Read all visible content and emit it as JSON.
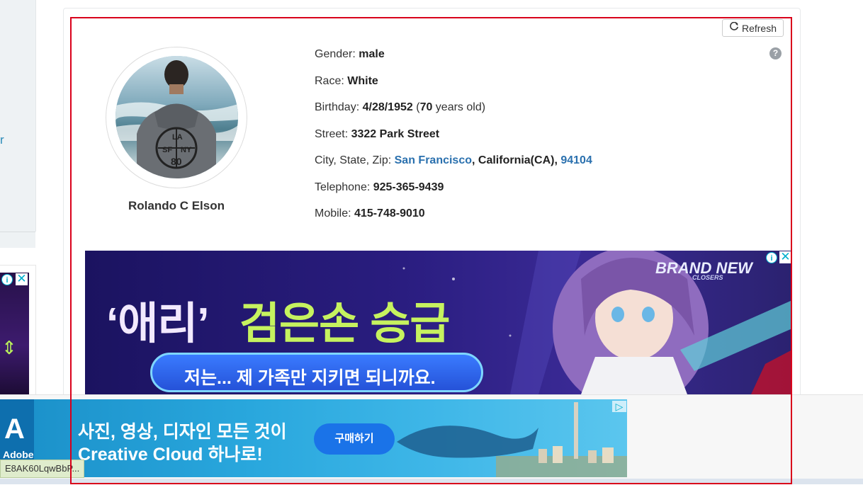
{
  "profile": {
    "name": "Rolando C Elson",
    "refresh_label": "Refresh",
    "help_icon": "question-circle-icon",
    "fields": [
      {
        "label": "Gender: ",
        "value": "male"
      },
      {
        "label": "Race: ",
        "value": "White"
      },
      {
        "label": "Birthday: ",
        "value": "4/28/1952",
        "paren_open": " (",
        "age": "70",
        "age_suffix": " years old)"
      },
      {
        "label": "Street: ",
        "value": "3322 Park Street"
      },
      {
        "label": "City, State, Zip: ",
        "city": "San Francisco",
        "sep1": ", ",
        "state": "California(CA)",
        "sep2": ", ",
        "zip": "94104"
      },
      {
        "label": "Telephone: ",
        "value": "925-365-9439"
      },
      {
        "label": "Mobile: ",
        "value": "415-748-9010"
      }
    ],
    "hoodie_text": [
      "LA",
      "SF",
      "NY",
      "80"
    ]
  },
  "banner_ad": {
    "title_quoted": "‘애리’",
    "title_rest": "검은손 승급",
    "subtitle": "저는... 제 가족만 지키면 되니까요.",
    "brand": "BRAND NEW",
    "brand_sub": "CLOSERS"
  },
  "bottom_ad": {
    "logo_text": "Adobe",
    "line1": "사진, 영상, 디자인 모든 것이",
    "line2": "Creative Cloud 하나로!",
    "button": "구매하기"
  },
  "left_panel": {
    "link_char": "r"
  },
  "status_url": "E8AK60LqwBbP...",
  "colors": {
    "link": "#2a70ae",
    "frame": "#d9001b",
    "ad_icon": "#00aecd"
  }
}
